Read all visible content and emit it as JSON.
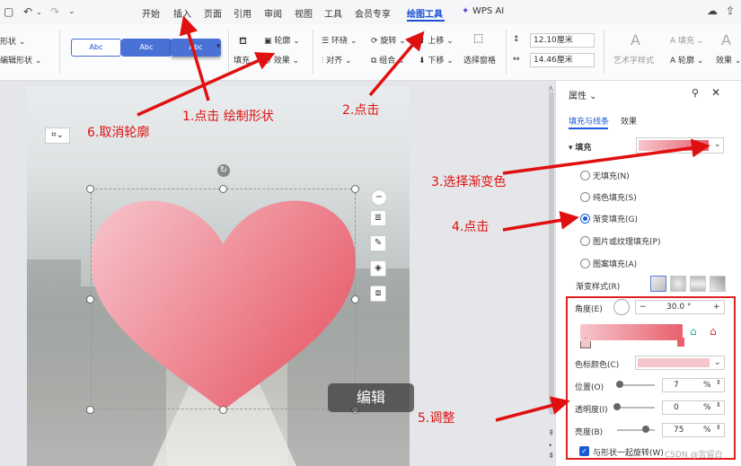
{
  "menubar": {
    "tabs": [
      "开始",
      "插入",
      "页面",
      "引用",
      "审阅",
      "视图",
      "工具",
      "会员专享",
      "绘图工具"
    ],
    "ai_label": "WPS AI",
    "active_tab": "绘图工具"
  },
  "ribbon": {
    "shape_label": "形状",
    "edit_shape_label": "编辑形状",
    "style_sample": "Abc",
    "outline_label": "轮廓",
    "effect_label": "效果",
    "fill_short": "填充",
    "wrap_label": "环绕",
    "align_label": "对齐",
    "rotate_label": "旋转",
    "group_label": "组合",
    "up_label": "上移",
    "down_label": "下移",
    "select_pane_label": "选择窗格",
    "height_value": "12.10厘米",
    "width_value": "14.46厘米",
    "art_text_label": "艺术字样式",
    "fill_label": "填充",
    "outline2_label": "轮廓",
    "effect2_label": "效果"
  },
  "canvas": {
    "edit_tip": "编辑"
  },
  "panel": {
    "title": "属性",
    "tab_fill_line": "填充与线条",
    "tab_effect": "效果",
    "fill_section": "填充",
    "fill_options": [
      "无填充(N)",
      "纯色填充(S)",
      "渐变填充(G)",
      "图片或纹理填充(P)",
      "图案填充(A)"
    ],
    "selected_option": "渐变填充(G)",
    "gradient_style_label": "渐变样式(R)",
    "angle_label": "角度(E)",
    "angle_value": "30.0 °",
    "stop_color_label": "色标颜色(C)",
    "position_label": "位置(O)",
    "position_value": "7",
    "transparency_label": "透明度(I)",
    "transparency_value": "0",
    "brightness_label": "亮度(B)",
    "brightness_value": "75",
    "percent": "%",
    "rotate_with_shape": "与形状一起旋转(W)",
    "colors": {
      "gradient_start": "#f7c5cc",
      "gradient_end": "#e8606e",
      "accent": "#1a5ad6"
    },
    "levels": {
      "position": 7,
      "transparency": 0,
      "brightness": 75
    }
  },
  "annotations": {
    "a1": "1.点击 绘制形状",
    "a2": "2.点击",
    "a3": "3.选择渐变色",
    "a4": "4.点击",
    "a5": "5.调整",
    "a6": "6.取消轮廓"
  },
  "watermark": "CSDN @宫留白"
}
